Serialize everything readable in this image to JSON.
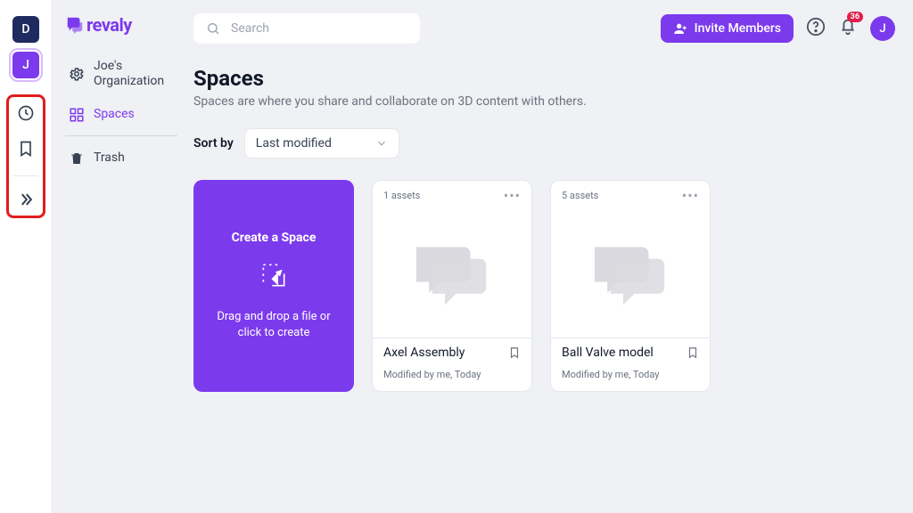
{
  "rail": {
    "d_label": "D",
    "j_label": "J"
  },
  "logo": {
    "text": "revaly"
  },
  "sidenav": {
    "org_label": "Joe's Organization",
    "spaces_label": "Spaces",
    "trash_label": "Trash"
  },
  "search": {
    "placeholder": "Search"
  },
  "header": {
    "invite_label": "Invite Members",
    "notification_count": "36",
    "avatar_initial": "J"
  },
  "page": {
    "title": "Spaces",
    "subtitle": "Spaces are where you share and collaborate on 3D content with others.",
    "sort_label": "Sort by",
    "sort_value": "Last modified"
  },
  "create": {
    "title": "Create a Space",
    "desc": "Drag and drop a file or click to create"
  },
  "spaces": [
    {
      "assets": "1 assets",
      "name": "Axel Assembly",
      "meta": "Modified by me, Today"
    },
    {
      "assets": "5 assets",
      "name": "Ball Valve model",
      "meta": "Modified by me, Today"
    }
  ]
}
